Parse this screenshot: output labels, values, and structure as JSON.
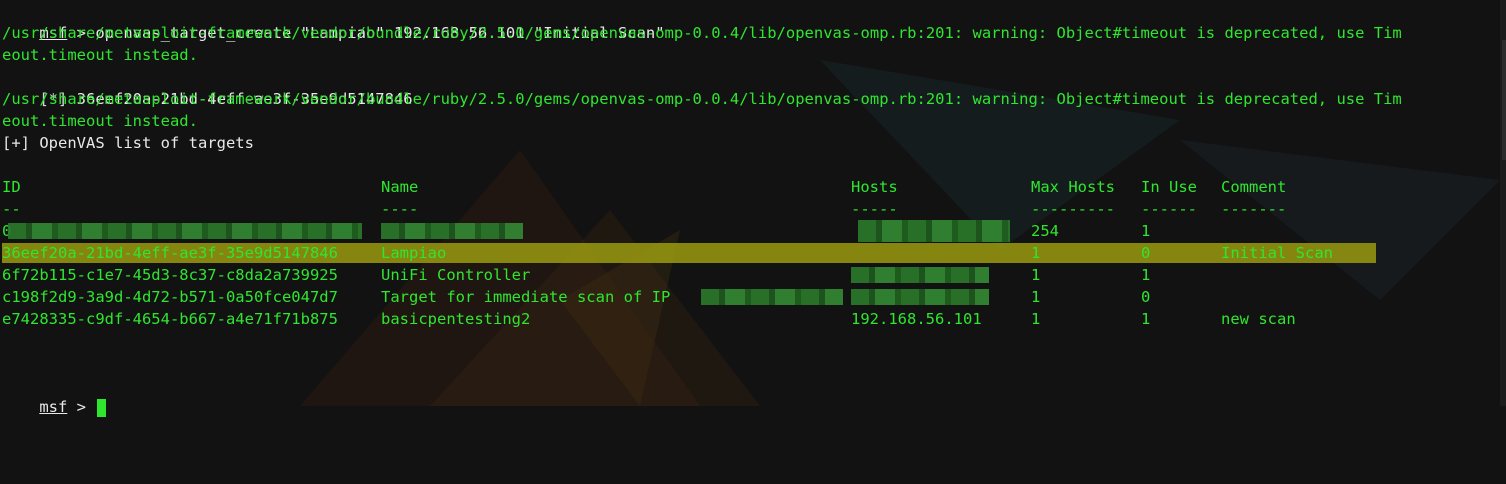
{
  "terminal": {
    "prompt": "msf",
    "prompt_symbol": " > ",
    "command": "openvas_target_create \"Lampiao\" 192.168.56.101 \"Initial Scan\"",
    "warning_line1a": "/usr/share/metasploit-framework/vendor/bundle/ruby/2.5.0/gems/openvas-omp-0.0.4/lib/openvas-omp.rb:201: warning: Object#timeout is deprecated, use Tim",
    "warning_line1b": "eout.timeout instead.",
    "star_prefix": "[*] ",
    "created_id": "36eef20a-21bd-4eff-ae3f-35e9d5147846",
    "warning_line2a": "/usr/share/metasploit-framework/vendor/bundle/ruby/2.5.0/gems/openvas-omp-0.0.4/lib/openvas-omp.rb:201: warning: Object#timeout is deprecated, use Tim",
    "warning_line2b": "eout.timeout instead.",
    "plus_line": "[+] OpenVAS list of targets",
    "accent_color": "#2fe62f",
    "highlight_color": "#9a9a10"
  },
  "table": {
    "headers": {
      "id": "ID",
      "name": "Name",
      "hosts": "Hosts",
      "max_hosts": "Max Hosts",
      "in_use": "In Use",
      "comment": "Comment"
    },
    "separators": {
      "id": "--",
      "name": "----",
      "hosts": "-----",
      "max_hosts": "---------",
      "in_use": "------",
      "comment": "-------"
    },
    "rows": [
      {
        "id": "0",
        "name": "",
        "hosts": "",
        "max_hosts": "254",
        "in_use": "1",
        "comment": ""
      },
      {
        "id": "36eef20a-21bd-4eff-ae3f-35e9d5147846",
        "name": "Lampiao",
        "hosts": "",
        "max_hosts": "1",
        "in_use": "0",
        "comment": "Initial Scan"
      },
      {
        "id": "6f72b115-c1e7-45d3-8c37-c8da2a739925",
        "name": "UniFi Controller",
        "hosts": "",
        "max_hosts": "1",
        "in_use": "1",
        "comment": ""
      },
      {
        "id": "c198f2d9-3a9d-4d72-b571-0a50fce047d7",
        "name": "Target for immediate scan of IP",
        "hosts": "",
        "max_hosts": "1",
        "in_use": "0",
        "comment": ""
      },
      {
        "id": "e7428335-c9df-4654-b667-a4e71f71b875",
        "name": "basicpentesting2",
        "hosts": "192.168.56.101",
        "max_hosts": "1",
        "in_use": "1",
        "comment": "new scan"
      }
    ]
  },
  "final_prompt": {
    "prompt": "msf",
    "symbol": " > "
  }
}
